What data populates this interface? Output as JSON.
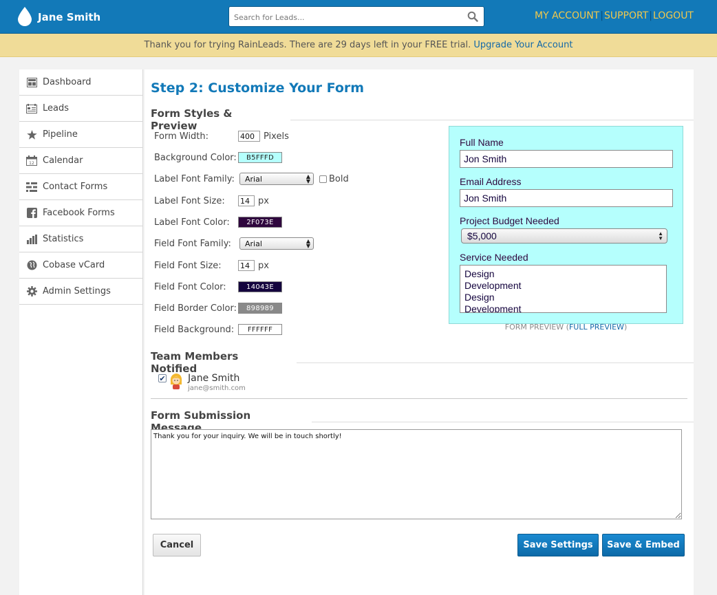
{
  "header": {
    "user_name": "Jane Smith",
    "search_placeholder": "Search for Leads...",
    "links": {
      "account": "MY ACCOUNT",
      "support": "SUPPORT",
      "logout": "LOGOUT",
      "separator": "|"
    }
  },
  "banner": {
    "text": "Thank you for trying RainLeads. There are 29 days left in your FREE trial.",
    "link": "Upgrade Your Account"
  },
  "sidebar": {
    "items": [
      {
        "label": "Dashboard",
        "icon": "dashboard-icon"
      },
      {
        "label": "Leads",
        "icon": "leads-icon"
      },
      {
        "label": "Pipeline",
        "icon": "star-icon"
      },
      {
        "label": "Calendar",
        "icon": "calendar-icon"
      },
      {
        "label": "Contact Forms",
        "icon": "form-icon"
      },
      {
        "label": "Facebook Forms",
        "icon": "facebook-icon"
      },
      {
        "label": "Statistics",
        "icon": "bar-chart-icon"
      },
      {
        "label": "Cobase vCard",
        "icon": "globe-icon"
      },
      {
        "label": "Admin Settings",
        "icon": "gear-icon"
      }
    ]
  },
  "main": {
    "title": "Step 2: Customize Your Form",
    "styles_heading": "Form Styles & Preview",
    "fields": {
      "form_width": {
        "label": "Form Width:",
        "value": "400",
        "unit": "Pixels"
      },
      "bg_color": {
        "label": "Background Color:",
        "value": "B5FFFD"
      },
      "label_font_family": {
        "label": "Label Font Family:",
        "value": "Arial",
        "bold_label": "Bold"
      },
      "label_font_size": {
        "label": "Label Font Size:",
        "value": "14",
        "unit": "px"
      },
      "label_font_color": {
        "label": "Label Font Color:",
        "value": "2F073E"
      },
      "field_font_family": {
        "label": "Field Font Family:",
        "value": "Arial"
      },
      "field_font_size": {
        "label": "Field Font Size:",
        "value": "14",
        "unit": "px"
      },
      "field_font_color": {
        "label": "Field Font Color:",
        "value": "14043E"
      },
      "field_border_color": {
        "label": "Field Border Color:",
        "value": "898989"
      },
      "field_background": {
        "label": "Field Background:",
        "value": "FFFFFF"
      }
    },
    "preview": {
      "full_name_label": "Full Name",
      "full_name_value": "Jon Smith",
      "email_label": "Email Address",
      "email_value": "Jon Smith",
      "budget_label": "Project Budget Needed",
      "budget_value": "$5,000",
      "service_label": "Service Needed",
      "service_options": [
        "Design",
        "Development",
        "Design",
        "Development"
      ],
      "caption_prefix": "FORM PREVIEW (",
      "caption_link": "FULL PREVIEW",
      "caption_suffix": ")"
    },
    "team_heading": "Team Members Notified",
    "member": {
      "name": "Jane Smith",
      "email": "jane@smith.com",
      "checked": true
    },
    "submission_heading": "Form Submission Message",
    "submission_message": "Thank you for your inquiry. We will be in touch shortly!",
    "buttons": {
      "cancel": "Cancel",
      "save_settings": "Save Settings",
      "save_embed": "Save & Embed"
    }
  },
  "colors": {
    "brand_blue": "#1279b8",
    "banner_bg": "#f0dc98",
    "link_yellow": "#f2c94c",
    "preview_bg": "#B5FFFD",
    "label_color": "#2F073E",
    "field_color": "#14043E",
    "border_color": "#898989"
  }
}
